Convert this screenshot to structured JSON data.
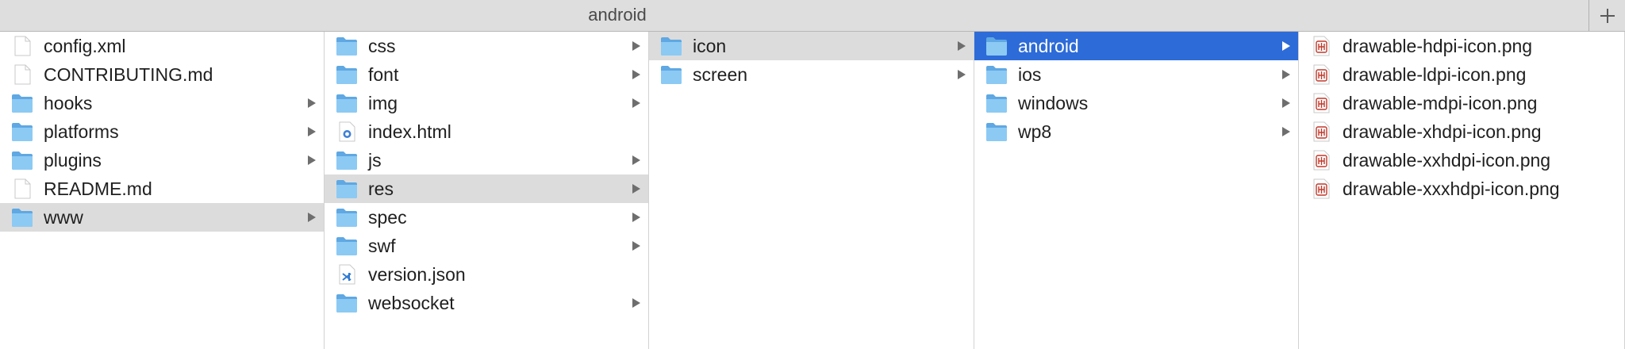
{
  "window": {
    "title": "android"
  },
  "columns": [
    {
      "items": [
        {
          "name": "config.xml",
          "kind": "file-icon",
          "has_children": false
        },
        {
          "name": "CONTRIBUTING.md",
          "kind": "file-icon",
          "has_children": false
        },
        {
          "name": "hooks",
          "kind": "folder-icon",
          "has_children": true
        },
        {
          "name": "platforms",
          "kind": "folder-icon",
          "has_children": true
        },
        {
          "name": "plugins",
          "kind": "folder-icon",
          "has_children": true
        },
        {
          "name": "README.md",
          "kind": "file-icon",
          "has_children": false
        },
        {
          "name": "www",
          "kind": "folder-icon",
          "has_children": true,
          "selected": "inactive"
        }
      ]
    },
    {
      "items": [
        {
          "name": "css",
          "kind": "folder-icon",
          "has_children": true
        },
        {
          "name": "font",
          "kind": "folder-icon",
          "has_children": true
        },
        {
          "name": "img",
          "kind": "folder-icon",
          "has_children": true
        },
        {
          "name": "index.html",
          "kind": "html-file-icon",
          "has_children": false
        },
        {
          "name": "js",
          "kind": "folder-icon",
          "has_children": true
        },
        {
          "name": "res",
          "kind": "folder-icon",
          "has_children": true,
          "selected": "inactive"
        },
        {
          "name": "spec",
          "kind": "folder-icon",
          "has_children": true
        },
        {
          "name": "swf",
          "kind": "folder-icon",
          "has_children": true
        },
        {
          "name": "version.json",
          "kind": "vscode-file-icon",
          "has_children": false
        },
        {
          "name": "websocket",
          "kind": "folder-icon",
          "has_children": true
        }
      ]
    },
    {
      "items": [
        {
          "name": "icon",
          "kind": "folder-icon",
          "has_children": true,
          "selected": "inactive"
        },
        {
          "name": "screen",
          "kind": "folder-icon",
          "has_children": true
        }
      ]
    },
    {
      "items": [
        {
          "name": "android",
          "kind": "folder-icon",
          "has_children": true,
          "selected": "active"
        },
        {
          "name": "ios",
          "kind": "folder-icon",
          "has_children": true
        },
        {
          "name": "windows",
          "kind": "folder-icon",
          "has_children": true
        },
        {
          "name": "wp8",
          "kind": "folder-icon",
          "has_children": true
        }
      ]
    },
    {
      "items": [
        {
          "name": "drawable-hdpi-icon.png",
          "kind": "png-file-icon",
          "has_children": false
        },
        {
          "name": "drawable-ldpi-icon.png",
          "kind": "png-file-icon",
          "has_children": false
        },
        {
          "name": "drawable-mdpi-icon.png",
          "kind": "png-file-icon",
          "has_children": false
        },
        {
          "name": "drawable-xhdpi-icon.png",
          "kind": "png-file-icon",
          "has_children": false
        },
        {
          "name": "drawable-xxhdpi-icon.png",
          "kind": "png-file-icon",
          "has_children": false
        },
        {
          "name": "drawable-xxxhdpi-icon.png",
          "kind": "png-file-icon",
          "has_children": false
        }
      ]
    }
  ],
  "colors": {
    "selection_active": "#2d6bd8",
    "selection_inactive": "#dcdcdc",
    "folder": "#7cc0f0"
  }
}
